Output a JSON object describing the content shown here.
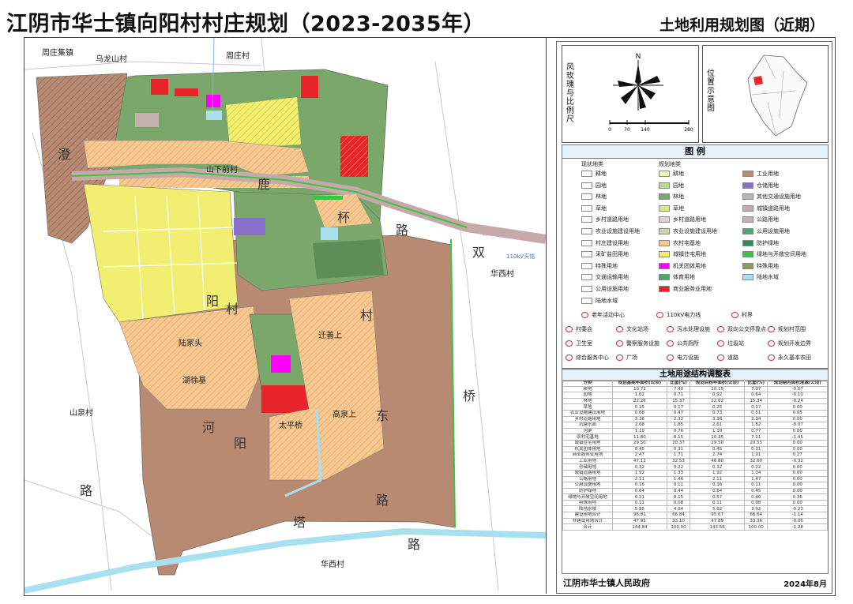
{
  "title": "江阴市华士镇向阳村村庄规划（2023-2035年）",
  "map_title": "土地利用规划图（近期）",
  "map": {
    "place_labels": [
      "周庄集镇",
      "乌龙山村",
      "周庄村",
      "华西村",
      "山泉村",
      "华西村"
    ],
    "area_labels": [
      "山下前村",
      "陆家头",
      "湖徐基",
      "迁善上",
      "太平桥",
      "高泉上",
      "110kV天铭"
    ],
    "road_chars": [
      "澄",
      "鹿",
      "杯",
      "双",
      "路",
      "阳",
      "村",
      "河",
      "阳",
      "村",
      "路",
      "桥",
      "路",
      "塔",
      "路",
      "东"
    ]
  },
  "panel": {
    "scale_box_label": "风玫瑰与比例尺",
    "north_label": "N",
    "scale_ticks": [
      "0",
      "70",
      "140",
      "280"
    ],
    "location_box_label": "位置示意图"
  },
  "legend": {
    "title": "图 例",
    "col_current": "现状地类",
    "col_planned": "规划地类",
    "current_items": [
      "耕地",
      "园地",
      "林地",
      "草地",
      "乡村道路用地",
      "农业设施建设用地",
      "村庄建设用地",
      "采矿盐田用地",
      "特殊用地",
      "交通运输用地",
      "公用设施用地",
      "陆地水域"
    ],
    "planned_items_1": [
      "耕地",
      "园地",
      "林地",
      "草地",
      "乡村道路用地",
      "农业设施建设用地",
      "农村宅基地",
      "城镇住宅用地",
      "机关团体用地",
      "体育用地",
      "商业服务业用地"
    ],
    "planned_items_2": [
      "工业用地",
      "仓储用地",
      "其他交通设施用地",
      "城镇道路用地",
      "公路用地",
      "公用设施用地",
      "防护绿地",
      "绿地与开敞空间用地",
      "特殊用地",
      "陆地水域"
    ],
    "symbols_1": [
      "老年活动中心",
      "110kV电力线",
      "村界"
    ],
    "symbols_2": [
      "村委会",
      "文化站场",
      "污水处理设施",
      "双向公交停靠点",
      "规划村范围"
    ],
    "symbols_3": [
      "卫生室",
      "警察服务设施",
      "公共厕所",
      "垃圾站",
      "规划开发边界"
    ],
    "symbols_4": [
      "综合服务中心",
      "广场",
      "电力设施",
      "道路",
      "永久基本农田"
    ]
  },
  "table": {
    "title": "土地用途结构调整表",
    "headers": [
      "分类",
      "规划基期年面积(公顷)",
      "比重(%)",
      "规划目标年面积(公顷)",
      "比重(%)",
      "规划期内面积增减(公顷)"
    ],
    "rows": [
      [
        "耕地",
        "10.72",
        "7.40",
        "10.15",
        "7.07",
        "-0.57"
      ],
      [
        "园地",
        "1.02",
        "0.71",
        "0.92",
        "0.64",
        "-0.10"
      ],
      [
        "林地",
        "22.26",
        "15.37",
        "22.02",
        "15.34",
        "-0.24"
      ],
      [
        "草地",
        "0.25",
        "0.17",
        "0.25",
        "0.17",
        "0.00"
      ],
      [
        "农业设施建设用地",
        "0.68",
        "0.47",
        "0.73",
        "0.51",
        "0.05"
      ],
      [
        "乡村道路用地",
        "3.36",
        "2.32",
        "3.36",
        "2.34",
        "0.00"
      ],
      [
        "坑塘水面",
        "2.68",
        "1.85",
        "2.61",
        "1.82",
        "-0.07"
      ],
      [
        "沟渠",
        "1.10",
        "0.76",
        "1.10",
        "0.77",
        "0.00"
      ],
      [
        "农村宅基地",
        "11.80",
        "8.15",
        "10.35",
        "7.21",
        "-1.45"
      ],
      [
        "城镇住宅用地",
        "29.50",
        "20.37",
        "29.50",
        "20.55",
        "0.00"
      ],
      [
        "机关团体用地",
        "0.45",
        "0.31",
        "0.45",
        "0.31",
        "0.00"
      ],
      [
        "商业服务业用地",
        "2.47",
        "1.71",
        "2.74",
        "1.91",
        "0.27"
      ],
      [
        "工业用地",
        "47.12",
        "32.53",
        "46.80",
        "32.60",
        "-0.32"
      ],
      [
        "仓储用地",
        "0.32",
        "0.22",
        "0.32",
        "0.22",
        "0.00"
      ],
      [
        "城镇道路用地",
        "1.92",
        "1.33",
        "1.92",
        "1.34",
        "0.00"
      ],
      [
        "公路用地",
        "2.11",
        "1.46",
        "2.11",
        "1.47",
        "0.00"
      ],
      [
        "公用设施用地",
        "0.16",
        "0.11",
        "0.16",
        "0.11",
        "0.00"
      ],
      [
        "防护绿地",
        "0.64",
        "0.44",
        "0.64",
        "0.45",
        "0.00"
      ],
      [
        "绿地与开敞空间用地",
        "0.21",
        "0.15",
        "0.57",
        "0.40",
        "0.36"
      ],
      [
        "特殊用地",
        "0.11",
        "0.08",
        "0.11",
        "0.08",
        "0.00"
      ],
      [
        "陆地水域",
        "5.85",
        "4.04",
        "5.62",
        "3.92",
        "-0.23"
      ],
      [
        "建设用地合计",
        "96.81",
        "66.84",
        "95.67",
        "66.64",
        "-1.14"
      ],
      [
        "非建设用地合计",
        "47.95",
        "33.10",
        "47.89",
        "33.36",
        "-0.06"
      ],
      [
        "合计",
        "144.84",
        "100.00",
        "143.56",
        "100.00",
        "-1.28"
      ]
    ]
  },
  "footer": {
    "authority": "江阴市华士镇人民政府",
    "date": "2024年8月"
  },
  "colors": {
    "rural_homestead": "#f5c892",
    "urban_residential": "#f2ee71",
    "industrial": "#b98a72",
    "forest": "#7aa86a",
    "arable": "#edf5c0",
    "commercial": "#e8232a",
    "admin": "#ff00ff",
    "water": "#a8e0f0",
    "road": "#c8a9a9",
    "green_open": "#39c542"
  }
}
